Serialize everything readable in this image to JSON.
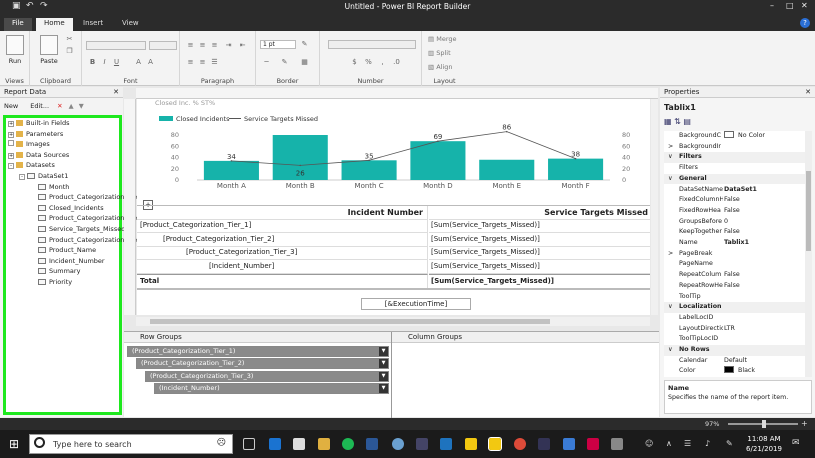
{
  "window": {
    "title": "Untitled - Power BI Report Builder"
  },
  "tabs": [
    "File",
    "Home",
    "Insert",
    "View"
  ],
  "ribbon": {
    "groups": [
      "Views",
      "Clipboard",
      "Font",
      "Paragraph",
      "Border",
      "Number",
      "Layout"
    ],
    "run_label": "Run",
    "paste_label": "Paste",
    "border_width": "1 pt",
    "merge_label": "Merge",
    "split_label": "Split",
    "align_label": "Align"
  },
  "report_data": {
    "title": "Report Data",
    "new_label": "New",
    "edit_label": "Edit...",
    "items": [
      {
        "label": "Built-in Fields",
        "type": "folder",
        "level": 0,
        "exp": "+"
      },
      {
        "label": "Parameters",
        "type": "folder",
        "level": 0,
        "exp": "+"
      },
      {
        "label": "Images",
        "type": "folder",
        "level": 0,
        "exp": ""
      },
      {
        "label": "Data Sources",
        "type": "folder",
        "level": 0,
        "exp": "+"
      },
      {
        "label": "Datasets",
        "type": "folder",
        "level": 0,
        "exp": "-"
      },
      {
        "label": "DataSet1",
        "type": "dataset",
        "level": 1,
        "exp": "-"
      },
      {
        "label": "Month",
        "type": "field",
        "level": 2,
        "exp": ""
      },
      {
        "label": "Product_Categorization_Tier_1",
        "type": "field",
        "level": 2,
        "exp": ""
      },
      {
        "label": "Closed_Incidents",
        "type": "field",
        "level": 2,
        "exp": ""
      },
      {
        "label": "Product_Categorization_Tier_2",
        "type": "field",
        "level": 2,
        "exp": ""
      },
      {
        "label": "Service_Targets_Missed",
        "type": "field",
        "level": 2,
        "exp": ""
      },
      {
        "label": "Product_Categorization_Tier_3",
        "type": "field",
        "level": 2,
        "exp": ""
      },
      {
        "label": "Product_Name",
        "type": "field",
        "level": 2,
        "exp": ""
      },
      {
        "label": "Incident_Number",
        "type": "field",
        "level": 2,
        "exp": ""
      },
      {
        "label": "Summary",
        "type": "field",
        "level": 2,
        "exp": ""
      },
      {
        "label": "Priority",
        "type": "field",
        "level": 2,
        "exp": ""
      }
    ]
  },
  "design": {
    "header_stub": "Closed Inc. % ST%",
    "execution_time": "[&ExecutionTime]"
  },
  "chart_data": {
    "type": "bar",
    "categories": [
      "Month A",
      "Month B",
      "Month C",
      "Month D",
      "Month E",
      "Month F"
    ],
    "series": [
      {
        "name": "Closed Incidents",
        "type": "bar",
        "values": [
          34,
          80,
          35,
          69,
          36,
          38
        ],
        "labels": [
          "34",
          "",
          "35",
          "69",
          "",
          ""
        ],
        "color": "#16b3aa"
      },
      {
        "name": "Service Targets Missed",
        "type": "line",
        "values": [
          34,
          26,
          35,
          69,
          86,
          38
        ],
        "labels": [
          "",
          "26",
          "",
          "",
          "86",
          "38"
        ],
        "color": "#555555"
      }
    ],
    "yticks": [
      "0",
      "20",
      "40",
      "60",
      "80"
    ],
    "ylim": [
      0,
      80
    ],
    "legend": "top-left"
  },
  "tablix": {
    "header_1": "Incident Number",
    "header_2": "Service Targets Missed",
    "rows": [
      {
        "c1": "[Product_Categorization_Tier_1]",
        "c2": "[Sum(Service_Targets_Missed)]",
        "indent": 0
      },
      {
        "c1": "[Product_Categorization_Tier_2]",
        "c2": "[Sum(Service_Targets_Missed)]",
        "indent": 1
      },
      {
        "c1": "[Product_Categorization_Tier_3]",
        "c2": "[Sum(Service_Targets_Missed)]",
        "indent": 2
      },
      {
        "c1": "[Incident_Number]",
        "c2": "[Sum(Service_Targets_Missed)]",
        "indent": 3
      }
    ],
    "total_label": "Total",
    "total_value": "[Sum(Service_Targets_Missed)]"
  },
  "groups": {
    "row_title": "Row Groups",
    "column_title": "Column Groups",
    "row_groups": [
      "(Product_Categorization_Tier_1)",
      "(Product_Categorization_Tier_2)",
      "(Product_Categorization_Tier_3)",
      "(Incident_Number)"
    ]
  },
  "properties": {
    "title": "Properties",
    "object": "Tablix1",
    "rows": [
      {
        "k": "BackgroundC",
        "v": "No Color",
        "swatch": "#ffffff"
      },
      {
        "k": "BackgroundIr",
        "v": "",
        "exp": ">"
      },
      {
        "cat": "Filters"
      },
      {
        "k": "Filters",
        "v": ""
      },
      {
        "cat": "General"
      },
      {
        "k": "DataSetName",
        "v": "DataSet1",
        "bold": true
      },
      {
        "k": "FixedColumnH",
        "v": "False"
      },
      {
        "k": "FixedRowHea",
        "v": "False"
      },
      {
        "k": "GroupsBefore",
        "v": "0"
      },
      {
        "k": "KeepTogether",
        "v": "False"
      },
      {
        "k": "Name",
        "v": "Tablix1",
        "bold": true
      },
      {
        "k": "PageBreak",
        "v": "",
        "exp": ">"
      },
      {
        "k": "PageName",
        "v": ""
      },
      {
        "k": "RepeatColum",
        "v": "False"
      },
      {
        "k": "RepeatRowHe",
        "v": "False"
      },
      {
        "k": "ToolTip",
        "v": ""
      },
      {
        "cat": "Localization"
      },
      {
        "k": "LabelLocID",
        "v": ""
      },
      {
        "k": "LayoutDirectio",
        "v": "LTR"
      },
      {
        "k": "ToolTipLocID",
        "v": ""
      },
      {
        "cat": "No Rows"
      },
      {
        "k": "Calendar",
        "v": "Default"
      },
      {
        "k": "Color",
        "v": "Black",
        "swatch": "#000000"
      }
    ],
    "help_title": "Name",
    "help_text": "Specifies the name of the report item."
  },
  "status": {
    "zoom": "97%"
  },
  "taskbar": {
    "search_placeholder": "Type here to search",
    "time": "11:08 AM",
    "date": "6/21/2019"
  }
}
